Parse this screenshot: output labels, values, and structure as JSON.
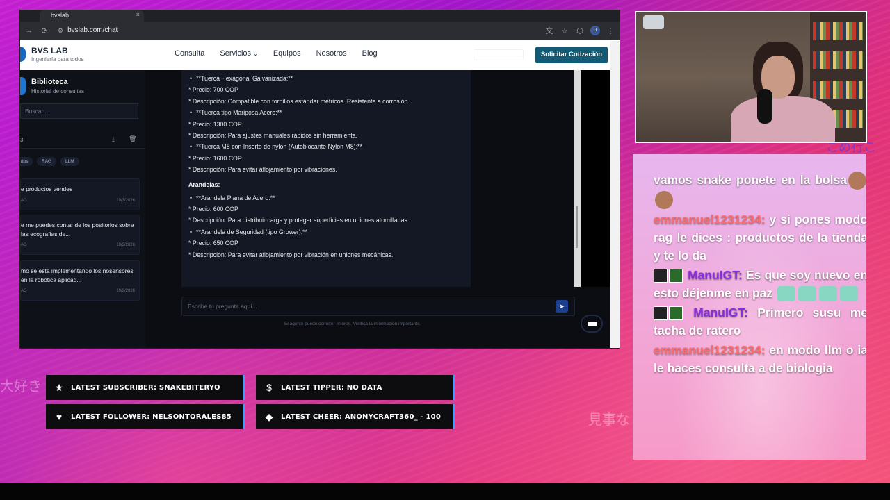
{
  "browser": {
    "tab_title": "bvslab",
    "tab_close": "×",
    "url": "bvslab.com/chat",
    "profile_initial": "D"
  },
  "site": {
    "brand_title": "BVS LAB",
    "brand_sub": "Ingeniería para todos",
    "nav": [
      {
        "label": "Consulta"
      },
      {
        "label": "Servicios"
      },
      {
        "label": "Equipos"
      },
      {
        "label": "Nosotros"
      },
      {
        "label": "Blog"
      }
    ],
    "cta": "Solicitar Cotización"
  },
  "sidebar": {
    "title": "Biblioteca",
    "subtitle": "Historial de consultas",
    "search_placeholder": "Buscar...",
    "count": "3",
    "chips": [
      "dos",
      "RAG",
      "LLM"
    ],
    "conversations": [
      {
        "title": "e productos vendes",
        "tag": "AG",
        "date": "10/3/2026"
      },
      {
        "title": "e me puedes contar de los positorios sobre las ecografias de...",
        "tag": "AG",
        "date": "10/3/2026"
      },
      {
        "title": "mo se esta implementando los nosensores en la robotica aplicad...",
        "tag": "AG",
        "date": "10/3/2026"
      }
    ]
  },
  "chat": {
    "lines": [
      {
        "kind": "bullet",
        "text": "**Tuerca Hexagonal Galvanizada:**"
      },
      {
        "kind": "line",
        "text": "* Precio: 700 COP"
      },
      {
        "kind": "line",
        "text": "* Descripción: Compatible con tornillos estándar métricos. Resistente a corrosión."
      },
      {
        "kind": "bullet",
        "text": "**Tuerca tipo Mariposa Acero:**"
      },
      {
        "kind": "line",
        "text": "* Precio: 1300 COP"
      },
      {
        "kind": "line",
        "text": "* Descripción: Para ajustes manuales rápidos sin herramienta."
      },
      {
        "kind": "bullet",
        "text": "**Tuerca M8 con Inserto de nylon (Autoblocante Nylon M8):**"
      },
      {
        "kind": "line",
        "text": "* Precio: 1600 COP"
      },
      {
        "kind": "line",
        "text": "* Descripción: Para evitar aflojamiento por vibraciones."
      }
    ],
    "section_heading": "Arandelas:",
    "lines2": [
      {
        "kind": "bullet",
        "text": "**Arandela Plana de Acero:**"
      },
      {
        "kind": "line",
        "text": "* Precio: 600 COP"
      },
      {
        "kind": "line",
        "text": "* Descripción: Para distribuir carga y proteger superficies en uniones atornilladas."
      },
      {
        "kind": "bullet",
        "text": "**Arandela de Seguridad (tipo Grower):**"
      },
      {
        "kind": "line",
        "text": "* Precio: 650 COP"
      },
      {
        "kind": "line",
        "text": "* Descripción: Para evitar aflojamiento por vibración en uniones mecánicas."
      }
    ],
    "input_placeholder": "Escribe tu pregunta aquí...",
    "disclaimer": "El agente puede cometer errores. Verifica la información importante."
  },
  "alerts": {
    "subscriber": "LATEST SUBSCRIBER: SNAKEBITERYO",
    "tipper": "LATEST TIPPER: NO DATA",
    "follower": "LATEST FOLLOWER: NELSONTORALES85",
    "cheer": "LATEST CHEER: ANONYCRAFT360_ - 100"
  },
  "stream_chat": {
    "messages": [
      {
        "user": "",
        "user_color": "#ffffff",
        "text": "vamos snake ponete en la bolsa",
        "emotes": "faces"
      },
      {
        "user": "emmanuel1231234:",
        "user_color": "#ff6a6a",
        "text": "y si pones modo rag le dices : productos de la tienda y te lo da",
        "emotes": ""
      },
      {
        "user": "ManuIGT:",
        "user_color": "#8a2be2",
        "text": "Es que soy nuevo en esto déjenme en paz",
        "emotes": "badge-cats"
      },
      {
        "user": "ManuIGT:",
        "user_color": "#8a2be2",
        "text": "Primero susu me tacha de ratero",
        "emotes": "badge"
      },
      {
        "user": "emmanuel1231234:",
        "user_color": "#ff6a6a",
        "text": "en modo llm o ia le haces consulta a de biologia",
        "emotes": ""
      }
    ]
  },
  "deco": {
    "left_jp": "大好き",
    "mid_jp": "見事な",
    "right_jp": "こめ行こ"
  },
  "colors": {
    "cta": "#135b74",
    "alert_border": "#3aa0ff",
    "user_emmanuel": "#ff6a6a",
    "user_manuigt": "#8a2be2"
  }
}
